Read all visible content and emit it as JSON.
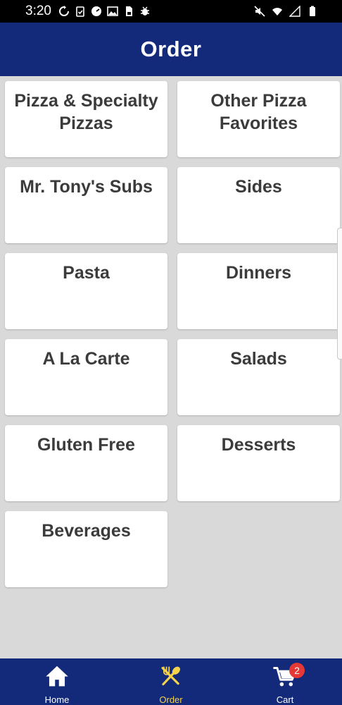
{
  "status_bar": {
    "time": "3:20",
    "left_icons": [
      "sync-icon",
      "clipboard-icon",
      "speedometer-icon",
      "image-icon",
      "sd-card-icon",
      "bug-icon"
    ],
    "right_icons": [
      "mute-icon",
      "wifi-icon",
      "signal-icon",
      "battery-icon"
    ]
  },
  "header": {
    "title": "Order"
  },
  "categories": [
    {
      "label": "Pizza & Specialty Pizzas"
    },
    {
      "label": "Other Pizza Favorites"
    },
    {
      "label": "Mr. Tony's Subs"
    },
    {
      "label": "Sides"
    },
    {
      "label": "Pasta"
    },
    {
      "label": "Dinners"
    },
    {
      "label": "A La Carte"
    },
    {
      "label": "Salads"
    },
    {
      "label": "Gluten Free"
    },
    {
      "label": "Desserts"
    },
    {
      "label": "Beverages"
    }
  ],
  "bottom_nav": {
    "home": {
      "label": "Home",
      "icon": "home-icon"
    },
    "order": {
      "label": "Order",
      "icon": "utensils-icon",
      "active": true
    },
    "cart": {
      "label": "Cart",
      "icon": "cart-icon",
      "badge": "2"
    }
  },
  "colors": {
    "brand_blue": "#13297a",
    "active_yellow": "#f4d24b",
    "badge_red": "#e53935",
    "background": "#d9d9d9"
  }
}
